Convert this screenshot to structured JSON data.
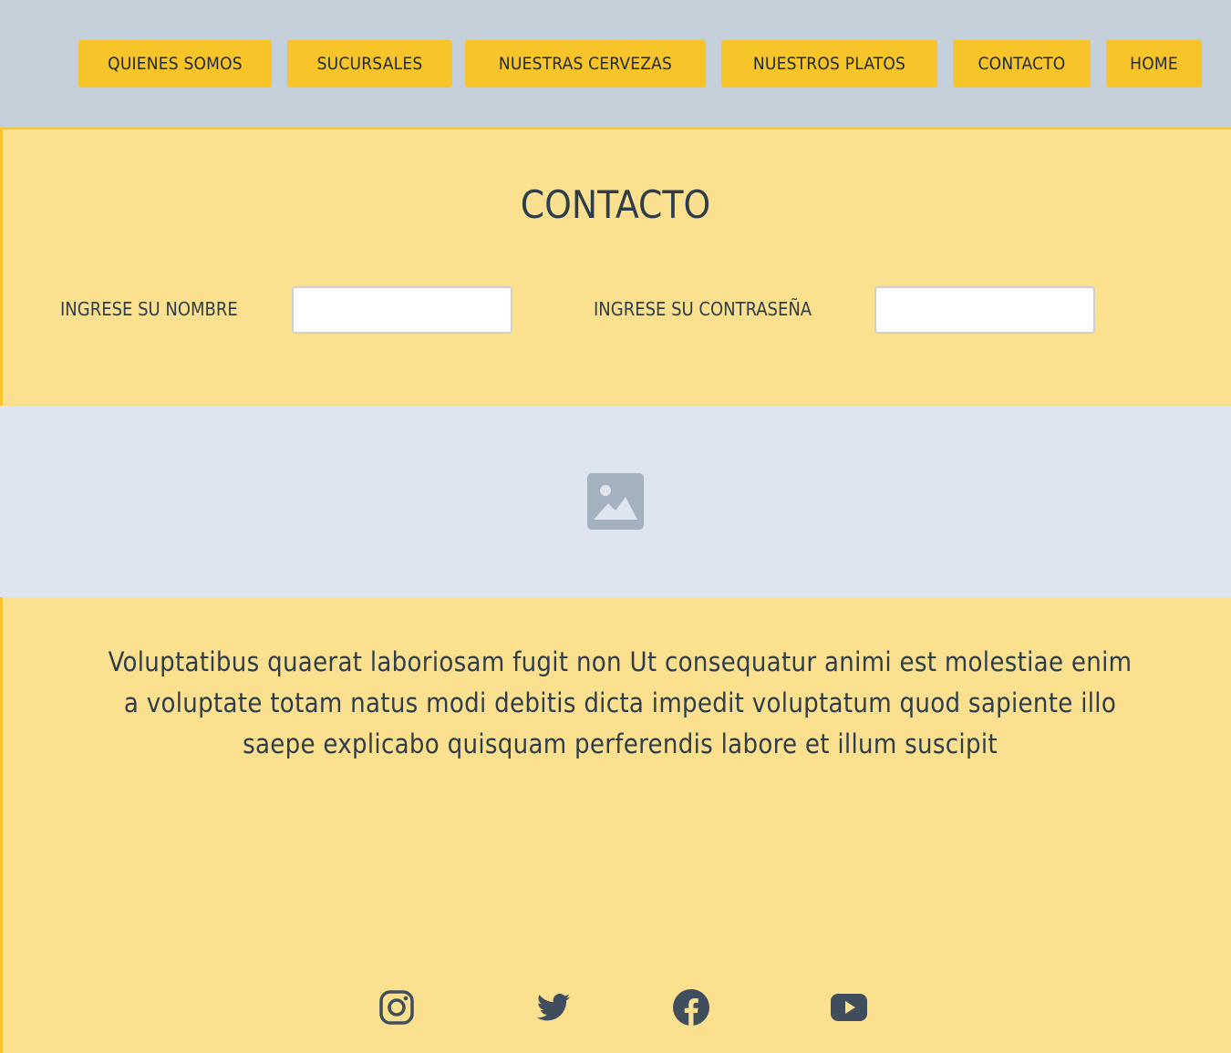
{
  "nav": {
    "items": [
      {
        "label": "QUIENES SOMOS"
      },
      {
        "label": "SUCURSALES"
      },
      {
        "label": "NUESTRAS CERVEZAS"
      },
      {
        "label": "NUESTROS PLATOS"
      },
      {
        "label": "CONTACTO"
      },
      {
        "label": "HOME"
      }
    ]
  },
  "contact": {
    "title": "CONTACTO",
    "name_label": "INGRESE SU NOMBRE",
    "name_value": "",
    "password_label": "INGRESE SU CONTRASEÑA",
    "password_value": ""
  },
  "image_placeholder": {
    "icon": "image-placeholder-icon"
  },
  "body": {
    "paragraph": "Voluptatibus quaerat laboriosam fugit non Ut consequatur animi est molestiae enim a voluptate totam natus modi debitis dicta impedit voluptatum quod sapiente illo saepe explicabo quisquam perferendis labore et illum suscipit"
  },
  "social": {
    "icons": [
      "instagram-icon",
      "twitter-icon",
      "facebook-icon",
      "youtube-icon"
    ]
  },
  "colors": {
    "accent": "#f7c52a",
    "background": "#fae08f",
    "topbar": "#c4cfd9",
    "image_band": "#dfe5ee",
    "text": "#2f3d4b"
  }
}
